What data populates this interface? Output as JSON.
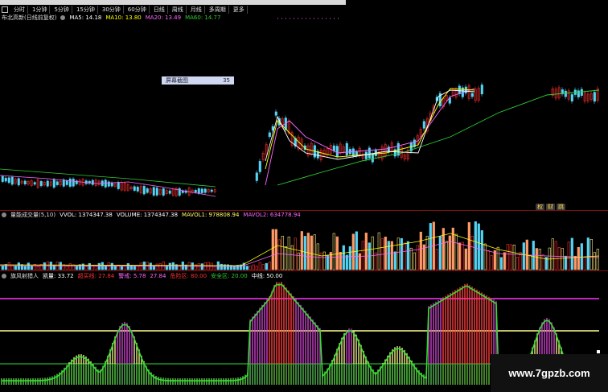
{
  "toolbar": {
    "items": [
      "分时",
      "1分钟",
      "5分钟",
      "15分钟",
      "30分钟",
      "60分钟",
      "日线",
      "周线",
      "月线",
      "多周期",
      "更多"
    ]
  },
  "price_panel": {
    "title": "布北高新(日线前复权)",
    "ma5": "MA5: 14.18",
    "ma10": "MA10: 13.80",
    "ma20": "MA20: 13.49",
    "ma60": "MA60: 14.77",
    "badge_screenshot": "屏幕截图",
    "badge_number": "35",
    "badges": [
      "权",
      "财",
      "跳"
    ]
  },
  "volume_panel": {
    "title": "量能成交量(5,10)",
    "vvol": "VVOL: 1374347.38",
    "volume": "VOLUME: 1374347.38",
    "mavol1": "MAVOL1: 978808.94",
    "mavol2": "MAVOL2: 634778.94"
  },
  "indicator_panel": {
    "title": "旗风射猎人",
    "kai": "凯量: 33.72",
    "a": "超买线: 27.84",
    "b": "警戒: 5.78",
    "c": "27.84",
    "d": "危险区: 80.00",
    "e": "安全区: 20.00",
    "f": "中线: 50.00"
  },
  "watermark": "www.7gpzb.com",
  "colors": {
    "up": "#ff3030",
    "down": "#54d4f4",
    "ma5": "#ffffff",
    "ma10": "#ffff00",
    "ma20": "#ff66ff",
    "ma60": "#33cc33",
    "magenta_line": "#ff33ff",
    "yellow_line": "#ffff88",
    "green_line": "#33dd33"
  }
}
